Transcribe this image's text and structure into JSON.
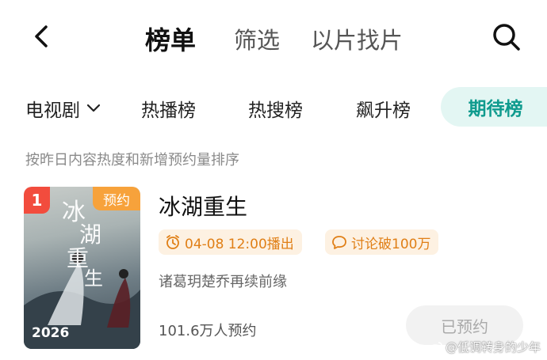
{
  "header": {
    "tabs": [
      {
        "label": "榜单",
        "active": true
      },
      {
        "label": "筛选",
        "active": false
      },
      {
        "label": "以片找片",
        "active": false
      }
    ],
    "back_icon": "chevron-left-icon",
    "search_icon": "search-icon"
  },
  "filter": {
    "genre": "电视剧",
    "chips": [
      {
        "label": "热播榜",
        "active": false
      },
      {
        "label": "热搜榜",
        "active": false
      },
      {
        "label": "飙升榜",
        "active": false
      },
      {
        "label": "期待榜",
        "active": true
      }
    ],
    "active_color": "#0f9b8e",
    "active_bg": "#e3f6f3"
  },
  "sort_note": "按昨日内容热度和新增预约量排序",
  "list": {
    "items": [
      {
        "rank": "1",
        "tag": "预约",
        "year": "2026",
        "title": "冰湖重生",
        "schedule": "04-08 12:00播出",
        "discussion": "讨论破100万",
        "description": "诸葛玥楚乔再续前缘",
        "reservations": "101.6万人预约",
        "button": "已预约"
      }
    ]
  },
  "watermark": "@低调转身的少年",
  "colors": {
    "rank_badge": "#f24c3d",
    "tag": "#f7a23b",
    "pill_text": "#e07f16",
    "pill_bg": "#fdf1e2"
  }
}
